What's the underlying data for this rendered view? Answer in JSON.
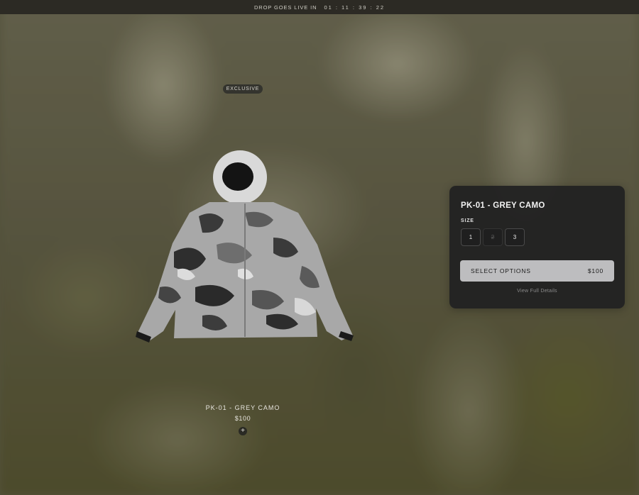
{
  "topbar": {
    "label": "DROP GOES LIVE IN",
    "countdown": "01 : 11 : 39 : 22"
  },
  "product": {
    "badge": "EXCLUSIVE",
    "name": "PK-01 - GREY CAMO",
    "price": "$100",
    "add_icon": "plus-icon",
    "image": "grey-camo-parka-with-fur-hood"
  },
  "panel": {
    "title": "PK-01 - GREY CAMO",
    "size_label": "SIZE",
    "sizes": [
      {
        "label": "1",
        "available": true
      },
      {
        "label": "2",
        "available": false
      },
      {
        "label": "3",
        "available": true
      }
    ],
    "select_label": "SELECT OPTIONS",
    "select_price": "$100",
    "details_link": "View Full Details"
  },
  "colors": {
    "topbar_bg": "#2c2a24",
    "panel_bg": "#222222",
    "button_bg": "#bdbdbf",
    "background": "#5d5b43"
  }
}
